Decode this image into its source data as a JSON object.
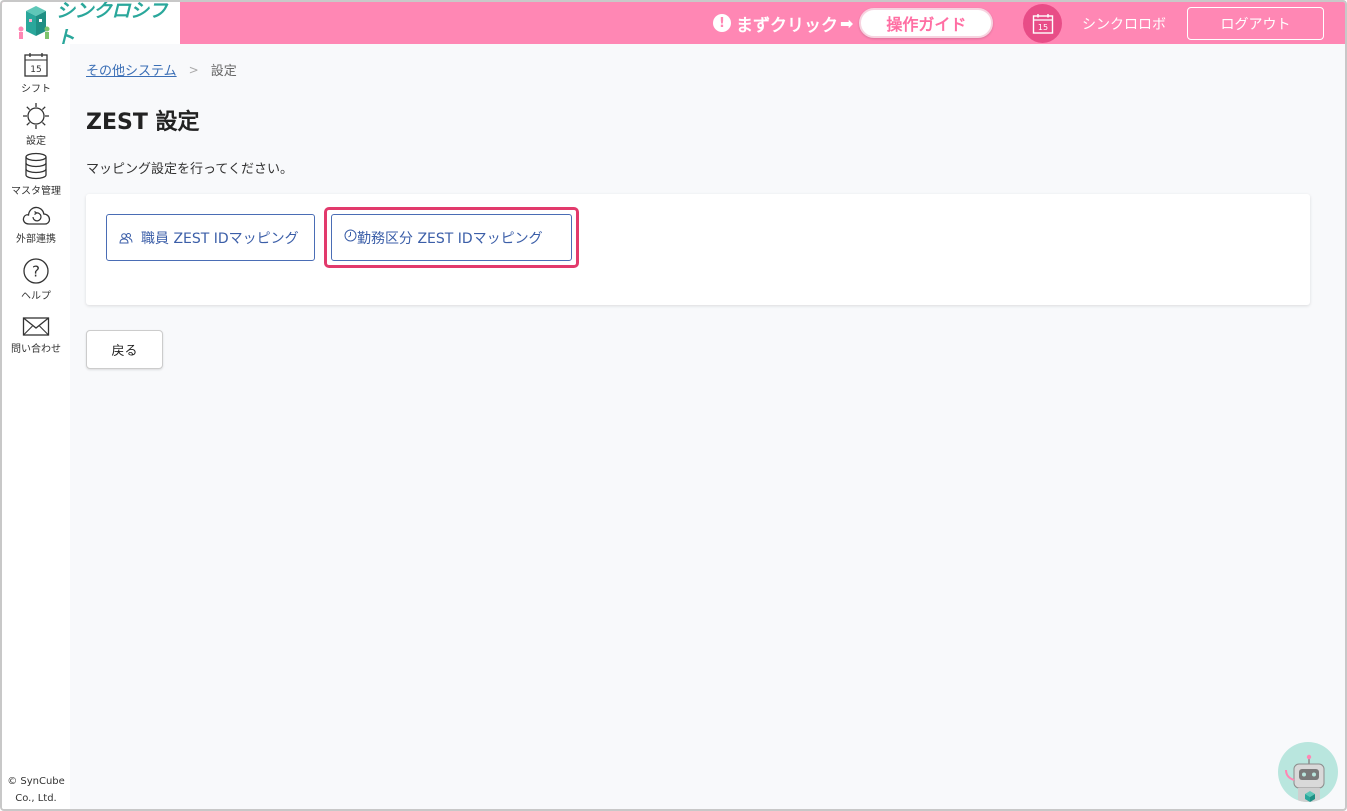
{
  "header": {
    "brand": "シンクロシフト",
    "guide_prompt": "まずクリック",
    "guide_button": "操作ガイド",
    "calendar_day": "15",
    "user_name": "シンクロロボ",
    "logout": "ログアウト",
    "accent": "#ff87b4"
  },
  "sidebar": {
    "items": [
      {
        "label": "シフト",
        "icon": "calendar-icon",
        "day": "15"
      },
      {
        "label": "設定",
        "icon": "gear-icon"
      },
      {
        "label": "マスタ管理",
        "icon": "database-icon"
      },
      {
        "label": "外部連携",
        "icon": "cloud-sync-icon"
      },
      {
        "label": "ヘルプ",
        "icon": "help-icon"
      },
      {
        "label": "問い合わせ",
        "icon": "mail-icon"
      }
    ],
    "copyright_line1": "© SynCube",
    "copyright_line2": "Co., Ltd."
  },
  "main": {
    "breadcrumb": {
      "link": "その他システム",
      "separator": ">",
      "current": "設定"
    },
    "title": "ZEST 設定",
    "description": "マッピング設定を行ってください。",
    "buttons": {
      "staff": "職員 ZEST IDマッピング",
      "shift": "勤務区分 ZEST IDマッピング"
    },
    "back": "戻る",
    "highlight_color": "#e23a6c"
  }
}
